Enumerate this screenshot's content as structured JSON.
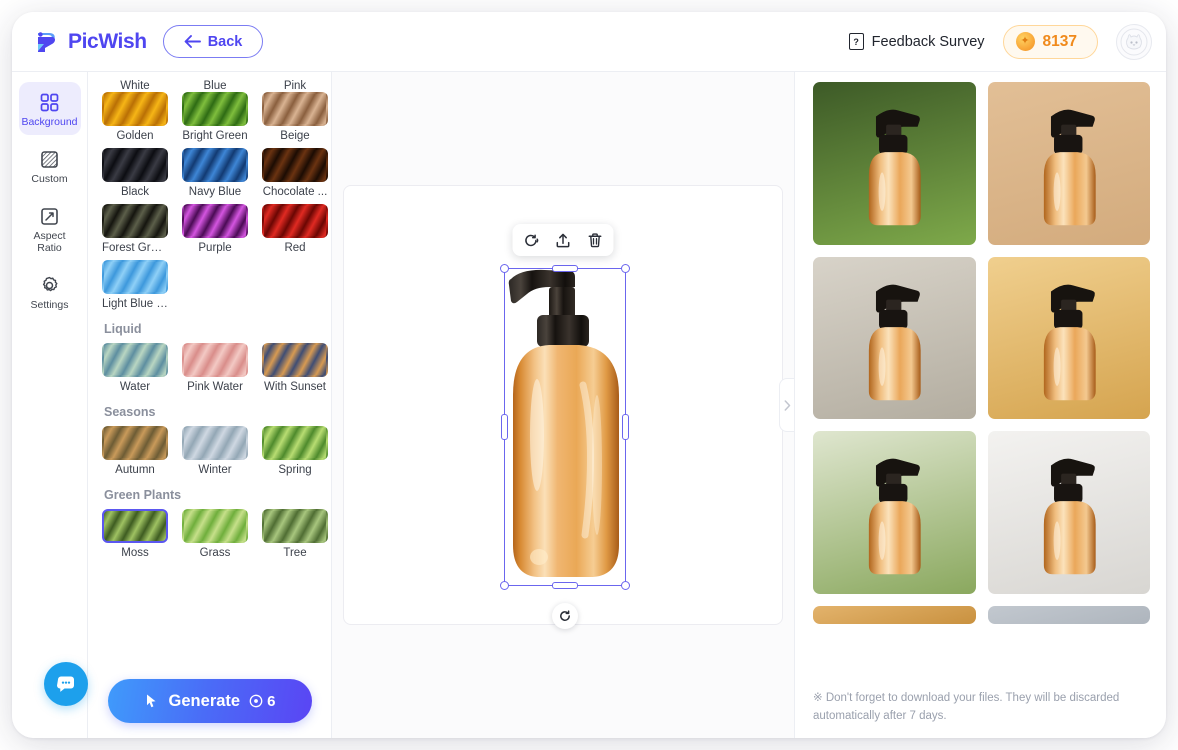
{
  "brand": {
    "name": "PicWish",
    "logo_icon": "picwish-logo-icon"
  },
  "header": {
    "back_label": "Back",
    "back_icon": "arrow-left-icon",
    "feedback_label": "Feedback Survey",
    "feedback_icon": "survey-doc-icon",
    "credits_value": "8137",
    "credits_icon": "coin-icon",
    "avatar_icon": "user-avatar-icon"
  },
  "rail": {
    "items": [
      {
        "label": "Background",
        "icon": "grid-squares-icon",
        "active": true
      },
      {
        "label": "Custom",
        "icon": "hatched-square-icon",
        "active": false
      },
      {
        "label": "Aspect Ratio",
        "icon": "resize-frame-icon",
        "active": false
      },
      {
        "label": "Settings",
        "icon": "gear-icon",
        "active": false
      }
    ]
  },
  "picker": {
    "top_partial_labels": [
      "White",
      "Blue",
      "Pink"
    ],
    "groups": [
      {
        "title": "",
        "swatches": [
          {
            "label": "Golden",
            "c1": "#f6b516",
            "c2": "#b96f05",
            "selected": false
          },
          {
            "label": "Bright Green",
            "c1": "#7fbe3d",
            "c2": "#2e6b14",
            "selected": false
          },
          {
            "label": "Beige",
            "c1": "#d9b392",
            "c2": "#8a5f3e",
            "selected": false
          },
          {
            "label": "Black",
            "c1": "#3a3b44",
            "c2": "#0c0d12",
            "selected": false
          },
          {
            "label": "Navy Blue",
            "c1": "#3e86d6",
            "c2": "#123a72",
            "selected": false
          },
          {
            "label": "Chocolate ...",
            "c1": "#6b3311",
            "c2": "#1c0c03",
            "selected": false
          },
          {
            "label": "Forest Green",
            "c1": "#5c5f4a",
            "c2": "#15150f",
            "selected": false
          },
          {
            "label": "Purple",
            "c1": "#d455e0",
            "c2": "#4b0b55",
            "selected": false
          },
          {
            "label": "Red",
            "c1": "#e02a22",
            "c2": "#6b0603",
            "selected": false
          },
          {
            "label": "Light Blue S…",
            "c1": "#8fd0f7",
            "c2": "#3d98dc",
            "selected": false
          }
        ]
      },
      {
        "title": "Liquid",
        "swatches": [
          {
            "label": "Water",
            "c1": "#b9d6c2",
            "c2": "#5d8ea0",
            "selected": false
          },
          {
            "label": "Pink Water",
            "c1": "#f3c9c4",
            "c2": "#d98d8a",
            "selected": false
          },
          {
            "label": "With Sunset",
            "c1": "#3f4d74",
            "c2": "#d79a52",
            "selected": false
          }
        ]
      },
      {
        "title": "Seasons",
        "swatches": [
          {
            "label": "Autumn",
            "c1": "#c99a5a",
            "c2": "#6d5c35",
            "selected": false
          },
          {
            "label": "Winter",
            "c1": "#cfd8e2",
            "c2": "#93a7b5",
            "selected": false
          },
          {
            "label": "Spring",
            "c1": "#b8dd72",
            "c2": "#4e8a2c",
            "selected": false
          }
        ]
      },
      {
        "title": "Green Plants",
        "swatches": [
          {
            "label": "Moss",
            "c1": "#9fc262",
            "c2": "#3e5c21",
            "selected": true
          },
          {
            "label": "Grass",
            "c1": "#c6e08a",
            "c2": "#6fae3c",
            "selected": false
          },
          {
            "label": "Tree",
            "c1": "#a8c67e",
            "c2": "#4f6d33",
            "selected": false
          }
        ]
      }
    ],
    "generate_label": "Generate",
    "generate_icon": "cursor-sparkle-icon",
    "generate_cost": "6",
    "generate_cost_icon": "credit-circle-icon"
  },
  "canvas": {
    "toolbar_icons": [
      "refresh-background-icon",
      "upload-icon",
      "delete-icon"
    ],
    "rotate_icon": "rotate-icon",
    "object_name": "product-bottle-image",
    "collapse_icon": "chevron-right-icon"
  },
  "results": {
    "items": [
      {
        "name": "result-forest-moss",
        "bg1": "#3d5a27",
        "bg2": "#7ea94a"
      },
      {
        "name": "result-beige-studio",
        "bg1": "#e2bf96",
        "bg2": "#d3ab7d"
      },
      {
        "name": "result-stone-wall",
        "bg1": "#d8d3c9",
        "bg2": "#b3ada0"
      },
      {
        "name": "result-golden-rocks",
        "bg1": "#f0cf8e",
        "bg2": "#d5a44f"
      },
      {
        "name": "result-white-flowers",
        "bg1": "#dfe6cf",
        "bg2": "#8aa85e"
      },
      {
        "name": "result-marble-plant",
        "bg1": "#f3f2f0",
        "bg2": "#d8d6d2"
      },
      {
        "name": "result-wood-clipped",
        "bg1": "#e3b36c",
        "bg2": "#c9913f"
      },
      {
        "name": "result-grey-clipped",
        "bg1": "#c2c8cf",
        "bg2": "#aeb5bd"
      }
    ],
    "note": "※ Don't forget to download your files. They will be discarded automatically after 7 days."
  },
  "chat": {
    "icon": "chat-bubble-icon"
  },
  "colors": {
    "accent": "#4f46f0",
    "selection": "#6b66ee",
    "credit": "#f08a1c",
    "chat": "#1da0ec"
  }
}
